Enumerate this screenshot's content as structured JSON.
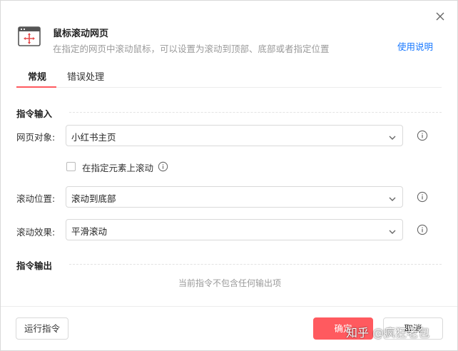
{
  "header": {
    "title": "鼠标滚动网页",
    "subtitle": "在指定的网页中滚动鼠标，可以设置为滚动到顶部、底部或者指定位置",
    "help_link": "使用说明",
    "icon": "window-move-icon"
  },
  "tabs": [
    {
      "label": "常规",
      "active": true
    },
    {
      "label": "错误处理",
      "active": false
    }
  ],
  "input_section": {
    "title": "指令输入",
    "fields": [
      {
        "label": "网页对象:",
        "value": "小红书主页"
      },
      {
        "label": "滚动位置:",
        "value": "滚动到底部"
      },
      {
        "label": "滚动效果:",
        "value": "平滑滚动"
      }
    ],
    "checkbox": {
      "label": "在指定元素上滚动",
      "checked": false
    }
  },
  "output_section": {
    "title": "指令输出",
    "empty_text": "当前指令不包含任何输出项"
  },
  "footer": {
    "run_label": "运行指令",
    "ok_label": "确定",
    "cancel_label": "取消"
  },
  "watermark": "知乎 @疯狂老包",
  "colors": {
    "accent": "#ff5a5f",
    "link": "#1677ff",
    "muted_text": "#9a9a9a"
  }
}
